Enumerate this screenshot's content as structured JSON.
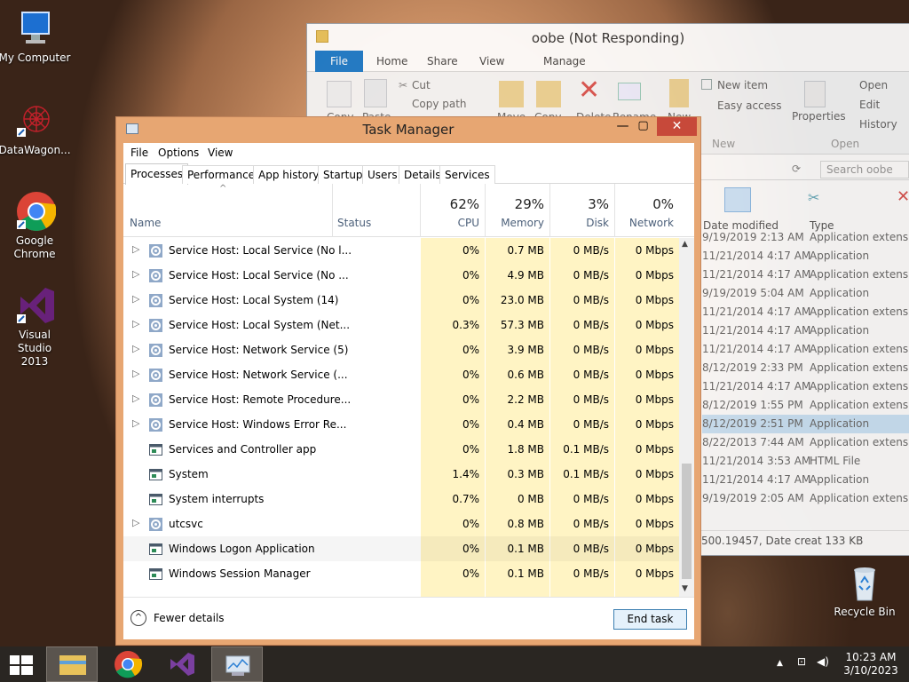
{
  "desktop": {
    "icons": [
      {
        "label": "My Computer"
      },
      {
        "label": "DataWagon..."
      },
      {
        "label": "Google Chrome"
      },
      {
        "label": "Visual Studio 2013"
      },
      {
        "label": "Recycle Bin"
      }
    ]
  },
  "explorer": {
    "title": "oobe (Not Responding)",
    "tabs": [
      "File",
      "Home",
      "Share",
      "View",
      "Manage"
    ],
    "ribbon": {
      "cut": "Cut",
      "copy_path": "Copy path",
      "new_item": "New item",
      "easy_access": "Easy access",
      "properties": "Properties",
      "open": "Open",
      "edit": "Edit",
      "history": "History",
      "new_group": "New",
      "open_group": "Open",
      "move": "Move",
      "copy_to": "Copy",
      "delete": "Delete",
      "rename": "Rename",
      "new_folder": "New",
      "copy": "Copy",
      "paste": "Paste"
    },
    "search_placeholder": "Search oobe",
    "columns": {
      "date": "Date modified",
      "type": "Type"
    },
    "rows": [
      {
        "date": "9/19/2019 2:13 AM",
        "type": "Application extens..."
      },
      {
        "date": "11/21/2014 4:17 AM",
        "type": "Application"
      },
      {
        "date": "11/21/2014 4:17 AM",
        "type": "Application extens..."
      },
      {
        "date": "9/19/2019 5:04 AM",
        "type": "Application"
      },
      {
        "date": "11/21/2014 4:17 AM",
        "type": "Application extens..."
      },
      {
        "date": "11/21/2014 4:17 AM",
        "type": "Application"
      },
      {
        "date": "11/21/2014 4:17 AM",
        "type": "Application extens..."
      },
      {
        "date": "8/12/2019 2:33 PM",
        "type": "Application extens..."
      },
      {
        "date": "11/21/2014 4:17 AM",
        "type": "Application extens..."
      },
      {
        "date": "8/12/2019 1:55 PM",
        "type": "Application extens..."
      },
      {
        "date": "8/12/2019 2:51 PM",
        "type": "Application"
      },
      {
        "date": "8/22/2013 7:44 AM",
        "type": "Application extens..."
      },
      {
        "date": "11/21/2014 3:53 AM",
        "type": "HTML File"
      },
      {
        "date": "11/21/2014 4:17 AM",
        "type": "Application"
      },
      {
        "date": "9/19/2019 2:05 AM",
        "type": "Application extens..."
      }
    ],
    "status": "500.19457, Date creat 133 KB"
  },
  "taskmanager": {
    "title": "Task Manager",
    "menu": [
      "File",
      "Options",
      "View"
    ],
    "tabs": [
      "Processes",
      "Performance",
      "App history",
      "Startup",
      "Users",
      "Details",
      "Services"
    ],
    "headers": {
      "name": "Name",
      "status": "Status",
      "cpu_pct": "62%",
      "cpu": "CPU",
      "mem_pct": "29%",
      "mem": "Memory",
      "disk_pct": "3%",
      "disk": "Disk",
      "net_pct": "0%",
      "net": "Network"
    },
    "rows": [
      {
        "name": "Service Host: Local Service (No l...",
        "cpu": "0%",
        "mem": "0.7 MB",
        "disk": "0 MB/s",
        "net": "0 Mbps",
        "expand": true,
        "icon": "gear-icon"
      },
      {
        "name": "Service Host: Local Service (No ...",
        "cpu": "0%",
        "mem": "4.9 MB",
        "disk": "0 MB/s",
        "net": "0 Mbps",
        "expand": true,
        "icon": "gear-icon"
      },
      {
        "name": "Service Host: Local System (14)",
        "cpu": "0%",
        "mem": "23.0 MB",
        "disk": "0 MB/s",
        "net": "0 Mbps",
        "expand": true,
        "icon": "gear-icon"
      },
      {
        "name": "Service Host: Local System (Net...",
        "cpu": "0.3%",
        "mem": "57.3 MB",
        "disk": "0 MB/s",
        "net": "0 Mbps",
        "expand": true,
        "icon": "gear-icon"
      },
      {
        "name": "Service Host: Network Service (5)",
        "cpu": "0%",
        "mem": "3.9 MB",
        "disk": "0 MB/s",
        "net": "0 Mbps",
        "expand": true,
        "icon": "gear-icon"
      },
      {
        "name": "Service Host: Network Service (...",
        "cpu": "0%",
        "mem": "0.6 MB",
        "disk": "0 MB/s",
        "net": "0 Mbps",
        "expand": true,
        "icon": "gear-icon"
      },
      {
        "name": "Service Host: Remote Procedure...",
        "cpu": "0%",
        "mem": "2.2 MB",
        "disk": "0 MB/s",
        "net": "0 Mbps",
        "expand": true,
        "icon": "gear-icon"
      },
      {
        "name": "Service Host: Windows Error Re...",
        "cpu": "0%",
        "mem": "0.4 MB",
        "disk": "0 MB/s",
        "net": "0 Mbps",
        "expand": true,
        "icon": "gear-icon"
      },
      {
        "name": "Services and Controller app",
        "cpu": "0%",
        "mem": "1.8 MB",
        "disk": "0.1 MB/s",
        "net": "0 Mbps",
        "expand": false,
        "icon": "window-icon"
      },
      {
        "name": "System",
        "cpu": "1.4%",
        "mem": "0.3 MB",
        "disk": "0.1 MB/s",
        "net": "0 Mbps",
        "expand": false,
        "icon": "window-icon"
      },
      {
        "name": "System interrupts",
        "cpu": "0.7%",
        "mem": "0 MB",
        "disk": "0 MB/s",
        "net": "0 Mbps",
        "expand": false,
        "icon": "window-icon"
      },
      {
        "name": "utcsvc",
        "cpu": "0%",
        "mem": "0.8 MB",
        "disk": "0 MB/s",
        "net": "0 Mbps",
        "expand": true,
        "icon": "gear-icon"
      },
      {
        "name": "Windows Logon Application",
        "cpu": "0%",
        "mem": "0.1 MB",
        "disk": "0 MB/s",
        "net": "0 Mbps",
        "expand": false,
        "icon": "window-icon"
      },
      {
        "name": "Windows Session Manager",
        "cpu": "0%",
        "mem": "0.1 MB",
        "disk": "0 MB/s",
        "net": "0 Mbps",
        "expand": false,
        "icon": "window-icon"
      }
    ],
    "fewer_details": "Fewer details",
    "end_task": "End task"
  },
  "taskbar": {
    "time": "10:23 AM",
    "date": "3/10/2023"
  }
}
